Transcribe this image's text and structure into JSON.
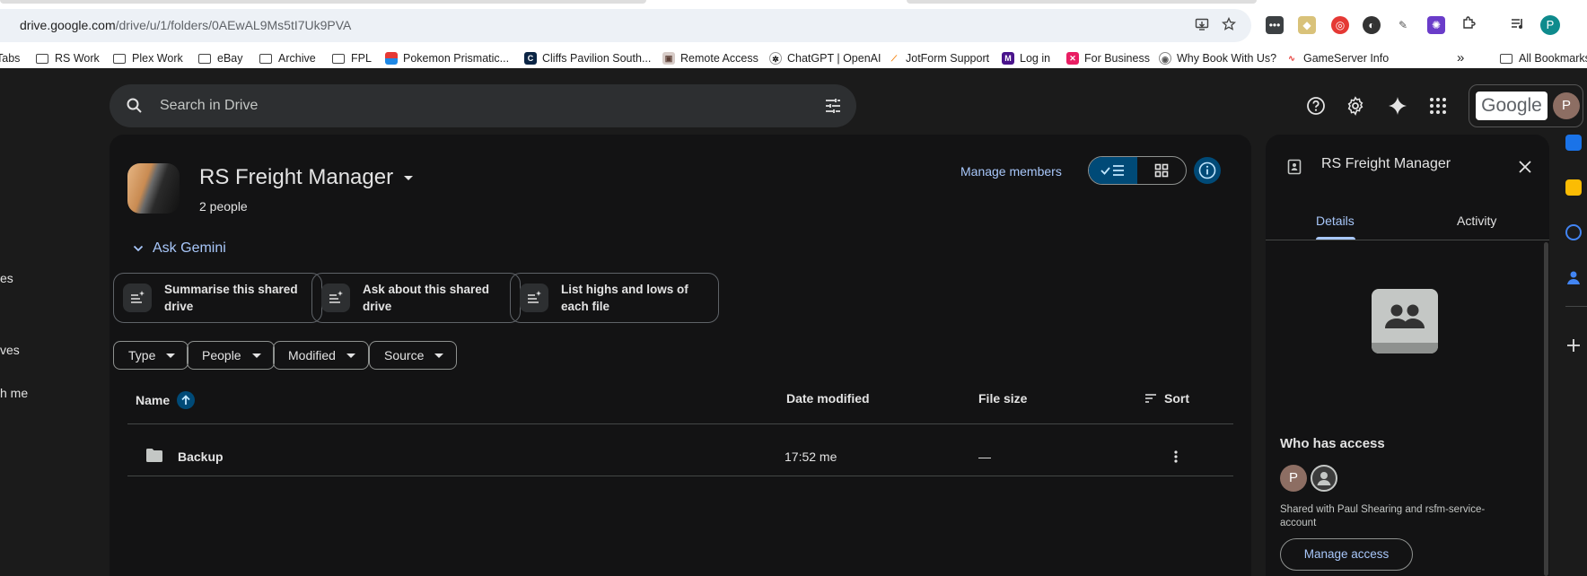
{
  "browser": {
    "url_host": "drive.google.com",
    "url_path": "/drive/u/1/folders/0AEwAL9Ms5tI7Uk9PVA",
    "profile_initial": "P",
    "bookmarks": [
      "Tabs",
      "RS Work",
      "Plex Work",
      "eBay",
      "Archive",
      "FPL",
      "Pokemon Prismatic...",
      "Cliffs Pavilion South...",
      "Remote Access",
      "ChatGPT | OpenAI",
      "JotForm Support",
      "Log in",
      "For Business",
      "Why Book With Us?",
      "GameServer Info",
      "All Bookmarks"
    ],
    "bookmarks_overflow": "»"
  },
  "leftnav": {
    "items": [
      "es",
      "ves",
      "h me"
    ]
  },
  "search": {
    "placeholder": "Search in Drive"
  },
  "header": {
    "google_label": "Google",
    "avatar_initial": "P"
  },
  "drive": {
    "name": "RS Freight Manager",
    "members": "2 people",
    "manage_members": "Manage members"
  },
  "gemini": {
    "label": "Ask Gemini",
    "suggestions": [
      "Summarise this shared drive",
      "Ask about this shared drive",
      "List highs and lows of each file"
    ]
  },
  "filters": [
    "Type",
    "People",
    "Modified",
    "Source"
  ],
  "table": {
    "columns": {
      "name": "Name",
      "date": "Date modified",
      "size": "File size",
      "sort": "Sort"
    },
    "rows": [
      {
        "name": "Backup",
        "date": "17:52 me",
        "size": "—"
      }
    ]
  },
  "panel": {
    "title": "RS Freight Manager",
    "tabs": [
      "Details",
      "Activity"
    ],
    "active_tab": "Details",
    "who_has_access": "Who has access",
    "avatar_initial": "P",
    "shared_with": "Shared with Paul Shearing and rsfm-service-account",
    "manage_access": "Manage access"
  },
  "colors": {
    "accent": "#a8c7fa",
    "selected_bg": "#004a77",
    "surface": "#131314",
    "background": "#1b1b1b"
  }
}
